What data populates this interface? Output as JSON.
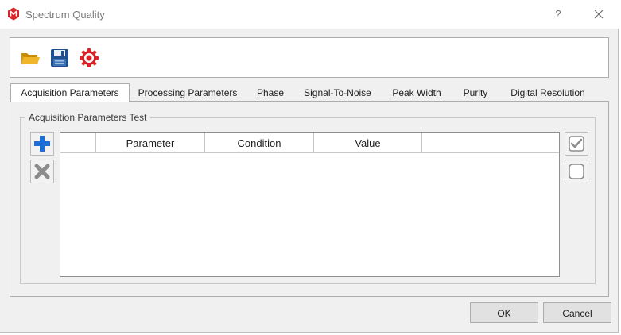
{
  "window": {
    "title": "Spectrum Quality",
    "help_label": "?",
    "icon": "app-logo-icon",
    "close_icon": "close-icon"
  },
  "toolbar": {
    "buttons": [
      {
        "icon": "folder-open-icon",
        "color": "#e8a50f"
      },
      {
        "icon": "save-disk-icon",
        "color": "#1d4f91"
      },
      {
        "icon": "settings-gear-icon",
        "color": "#d8232a"
      }
    ]
  },
  "tabs": [
    {
      "label": "Acquisition Parameters",
      "active": true
    },
    {
      "label": "Processing Parameters",
      "active": false
    },
    {
      "label": "Phase",
      "active": false
    },
    {
      "label": "Signal-To-Noise",
      "active": false
    },
    {
      "label": "Peak Width",
      "active": false
    },
    {
      "label": "Purity",
      "active": false
    },
    {
      "label": "Digital Resolution",
      "active": false
    }
  ],
  "group": {
    "title": "Acquisition Parameters Test"
  },
  "table": {
    "columns": [
      "",
      "Parameter",
      "Condition",
      "Value",
      ""
    ],
    "rows": []
  },
  "side_buttons": {
    "add_icon": "plus-icon",
    "remove_icon": "x-remove-icon",
    "check_all_icon": "check-icon",
    "uncheck_all_icon": "empty-checkbox-icon"
  },
  "footer": {
    "ok_label": "OK",
    "cancel_label": "Cancel"
  },
  "colors": {
    "accent_blue": "#1c6fd6",
    "brand_red": "#d8232a"
  }
}
